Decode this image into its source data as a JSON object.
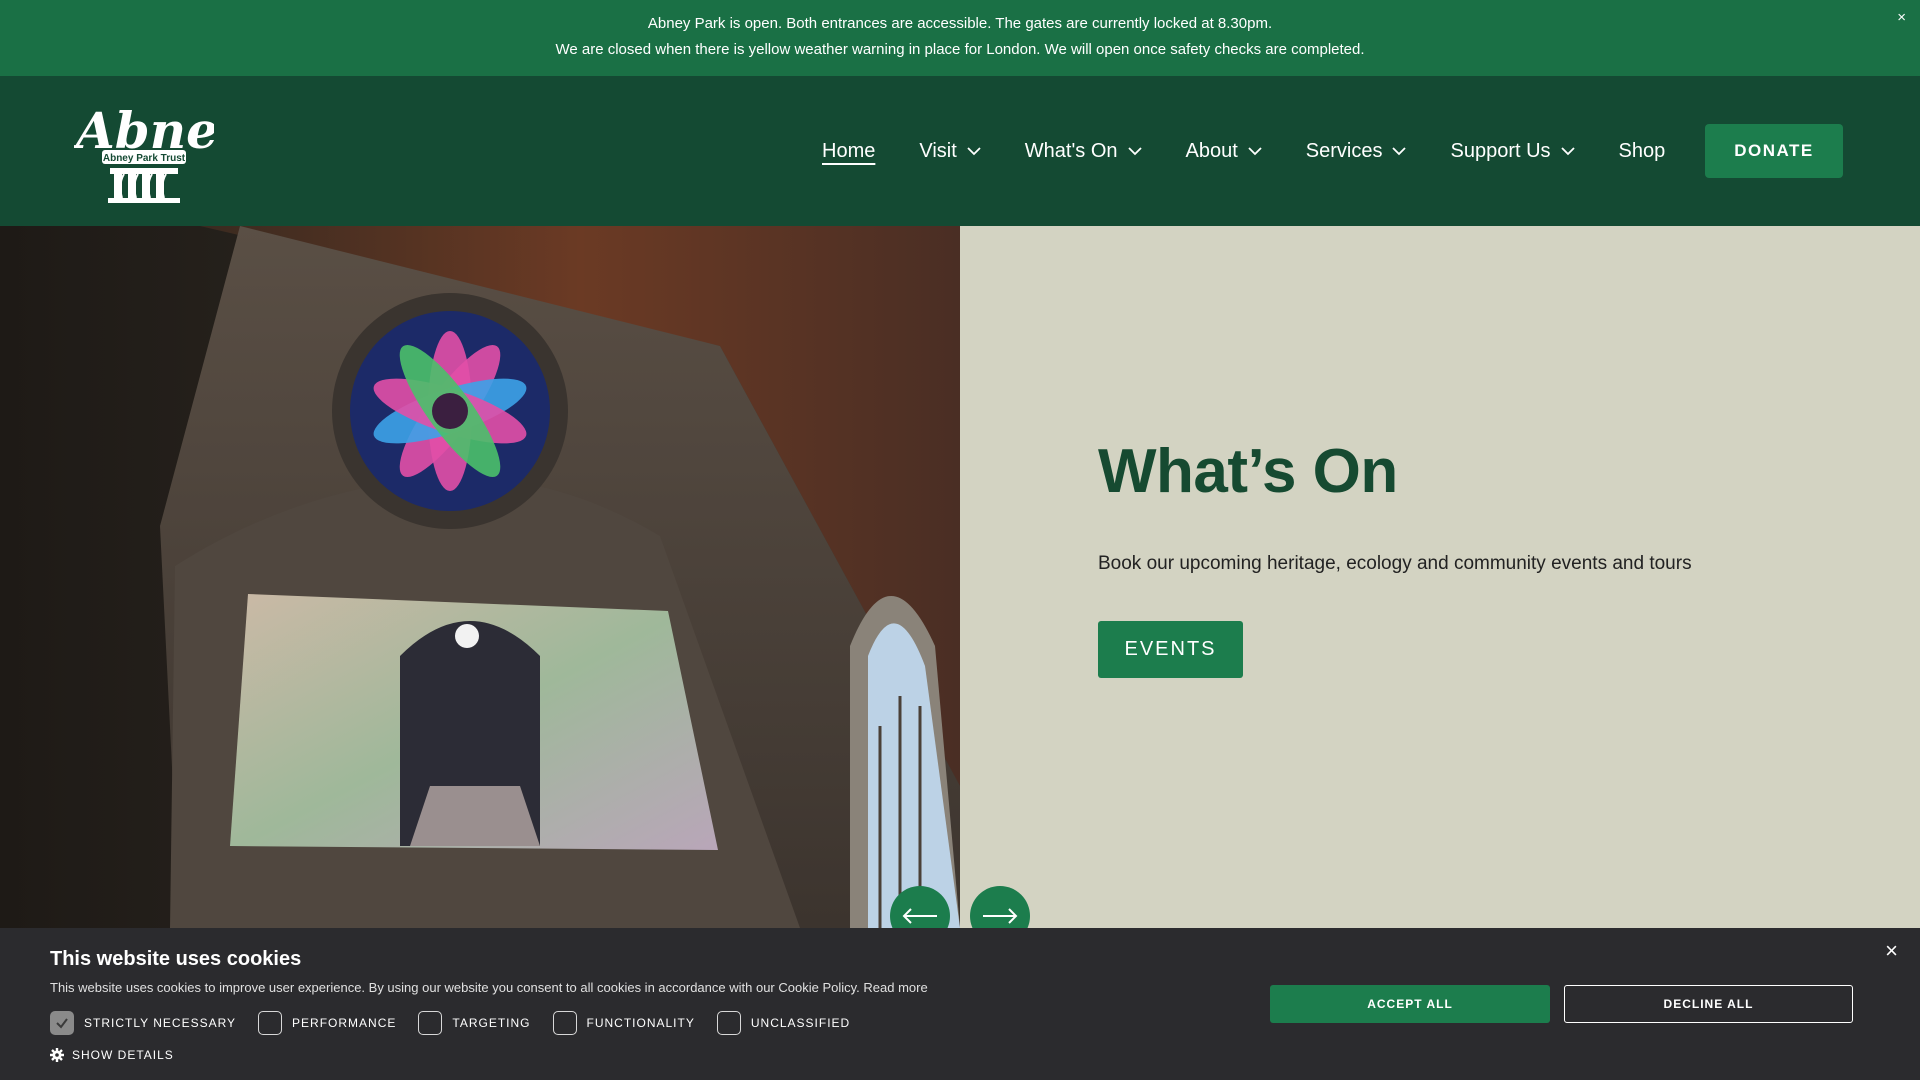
{
  "alert": {
    "line1": "Abney Park is open. Both entrances are accessible. The gates are currently locked at 8.30pm.",
    "line2": "We are closed when there is yellow weather warning in place for London. We will open once safety checks are completed.",
    "close": "×"
  },
  "logo": {
    "name": "Abney",
    "tagline": "Abney Park Trust"
  },
  "nav": {
    "items": [
      {
        "label": "Home",
        "active": true,
        "dropdown": false
      },
      {
        "label": "Visit",
        "dropdown": true
      },
      {
        "label": "What's On",
        "dropdown": true
      },
      {
        "label": "About",
        "dropdown": true
      },
      {
        "label": "Services",
        "dropdown": true
      },
      {
        "label": "Support Us",
        "dropdown": true
      },
      {
        "label": "Shop",
        "dropdown": false
      }
    ],
    "donate": "DONATE"
  },
  "hero": {
    "title": "What’s On",
    "subtitle": "Book our upcoming heritage, ecology and community events and tours",
    "button": "EVENTS",
    "prev_icon": "arrow-left-icon",
    "next_icon": "arrow-right-icon"
  },
  "cookie": {
    "title": "This website uses cookies",
    "text": "This website uses cookies to improve user experience. By using our website you consent to all cookies in accordance with our Cookie Policy.",
    "read_more": "Read more",
    "options": [
      {
        "label": "STRICTLY NECESSARY",
        "checked": true
      },
      {
        "label": "PERFORMANCE",
        "checked": false
      },
      {
        "label": "TARGETING",
        "checked": false
      },
      {
        "label": "FUNCTIONALITY",
        "checked": false
      },
      {
        "label": "UNCLASSIFIED",
        "checked": false
      }
    ],
    "show_details": "SHOW DETAILS",
    "accept": "ACCEPT ALL",
    "decline": "DECLINE ALL",
    "close": "×"
  },
  "colors": {
    "alert_bg": "#1a7045",
    "header_bg": "#144a33",
    "button_green": "#1c7d4d",
    "panel_bg": "#d3d3c2",
    "title_green": "#164a31",
    "cookie_bg": "#2b2b2e"
  }
}
